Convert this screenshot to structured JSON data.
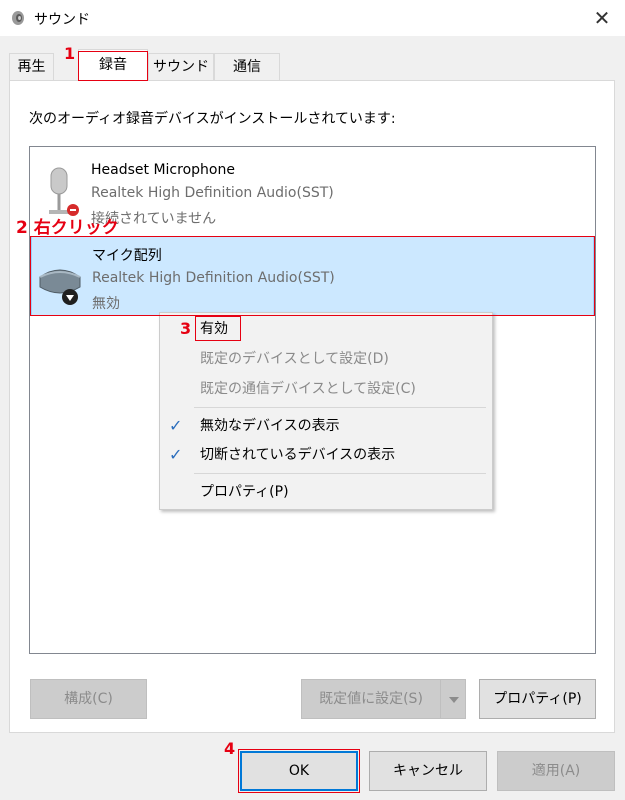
{
  "window": {
    "title": "サウンド",
    "close_label": "✕"
  },
  "tabs": [
    {
      "label": "再生"
    },
    {
      "label": "録音"
    },
    {
      "label": "サウンド"
    },
    {
      "label": "通信"
    }
  ],
  "description": "次のオーディオ録音デバイスがインストールされています:",
  "devices": [
    {
      "name": "Headset Microphone",
      "driver": "Realtek High Definition Audio(SST)",
      "status": "接続されていません"
    },
    {
      "name": "マイク配列",
      "driver": "Realtek High Definition Audio(SST)",
      "status": "無効"
    }
  ],
  "context_menu": {
    "items": [
      {
        "label": "有効",
        "disabled": false,
        "checked": false
      },
      {
        "label": "既定のデバイスとして設定(D)",
        "disabled": true,
        "checked": false
      },
      {
        "label": "既定の通信デバイスとして設定(C)",
        "disabled": true,
        "checked": false
      },
      {
        "label": "無効なデバイスの表示",
        "disabled": false,
        "checked": true
      },
      {
        "label": "切断されているデバイスの表示",
        "disabled": false,
        "checked": true
      },
      {
        "label": "プロパティ(P)",
        "disabled": false,
        "checked": false
      }
    ],
    "check_glyph": "✓"
  },
  "panel_buttons": {
    "configure": "構成(C)",
    "set_default": "既定値に設定(S)",
    "properties": "プロパティ(P)"
  },
  "dialog_buttons": {
    "ok": "OK",
    "cancel": "キャンセル",
    "apply": "適用(A)"
  },
  "annotations": {
    "step1": "1",
    "step2": "2 右クリック",
    "step3": "3",
    "step4": "4"
  },
  "colors": {
    "annotation": "#e60012",
    "selection": "#cce8ff",
    "default_button": "#0078d7"
  }
}
